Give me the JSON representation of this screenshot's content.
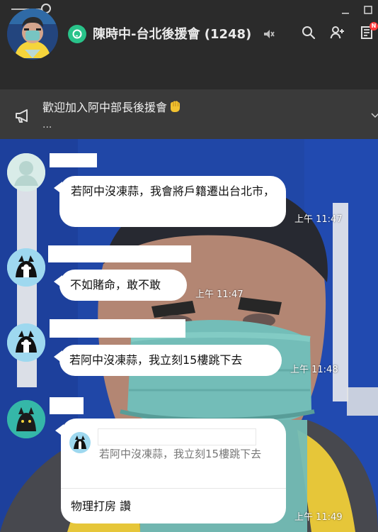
{
  "window": {
    "minimize_label": "minimize",
    "maximize_label": "maximize"
  },
  "header": {
    "chat_title": "陳時中-台北後援會 (1248)",
    "badge": "N"
  },
  "announcement": {
    "text": "歡迎加入阿中部長後援會",
    "ellipsis": "..."
  },
  "messages": [
    {
      "text": "若阿中沒凍蒜，我會將戶籍遷出台北市，",
      "time": "上午 11:47"
    },
    {
      "text": "不如賭命，敢不敢",
      "time": "上午 11:47"
    },
    {
      "text": "若阿中沒凍蒜，我立刻15樓跳下去",
      "time": "上午 11:48"
    },
    {
      "quoted_text": "若阿中沒凍蒜，我立刻15樓跳下去",
      "text": "物理打房 讚",
      "time": "上午 11:49"
    }
  ],
  "colors": {
    "header_bg": "#2b2b2b",
    "announcement_bg": "#3a3a3a",
    "openchat_green": "#29c38a",
    "badge_red": "#ff3b3b",
    "bubble_white": "#ffffff"
  }
}
